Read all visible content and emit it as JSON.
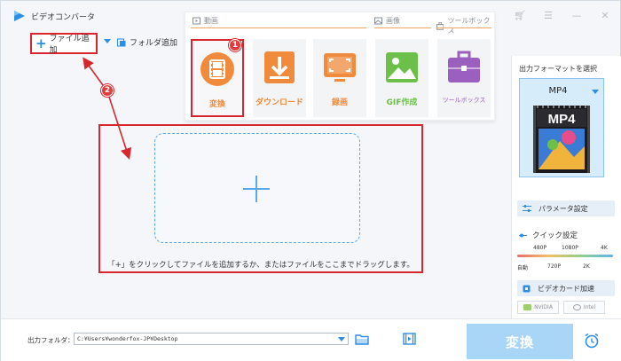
{
  "app": {
    "title": "ビデオコンバータ"
  },
  "toolbar": {
    "add_file_label": "ファイル追加",
    "add_folder_label": "フォルダ追加"
  },
  "tool_panel": {
    "sections": {
      "video": "動画",
      "image": "画像",
      "toolbox": "ツールボックス"
    },
    "tools": [
      {
        "label": "変換",
        "color": "#f08a3c"
      },
      {
        "label": "ダウンロード",
        "color": "#f08a3c"
      },
      {
        "label": "録画",
        "color": "#f08a3c"
      },
      {
        "label": "GIF作成",
        "color": "#6cc04a"
      },
      {
        "label": "ツールボックス",
        "color": "#9b5fc0"
      }
    ]
  },
  "drop_area": {
    "hint": "「+」をクリックしてファイルを追加するか、またはファイルをここまでドラッグします。"
  },
  "right_panel": {
    "title": "出力フォーマットを選択",
    "format": "MP4",
    "thumbnail_label": "MP4",
    "param_label": "パラメータ設定",
    "quick_label": "クイック設定",
    "quick_top": [
      "480P",
      "1080P",
      "4K"
    ],
    "quick_bottom": [
      "自動",
      "720P",
      "2K"
    ],
    "gpu_label": "ビデオカード加速",
    "gpu_chips": [
      "NVIDIA",
      "Intel"
    ]
  },
  "bottom": {
    "output_label": "出力フォルダ：",
    "output_path": "C:¥Users¥wonderfox-JP¥Desktop",
    "convert_label": "変換"
  },
  "annotations": {
    "badge1": "1",
    "badge2": "2"
  },
  "colors": {
    "accent": "#2d8ee6",
    "annotation_red": "#d8262f",
    "orange": "#f08a3c"
  }
}
